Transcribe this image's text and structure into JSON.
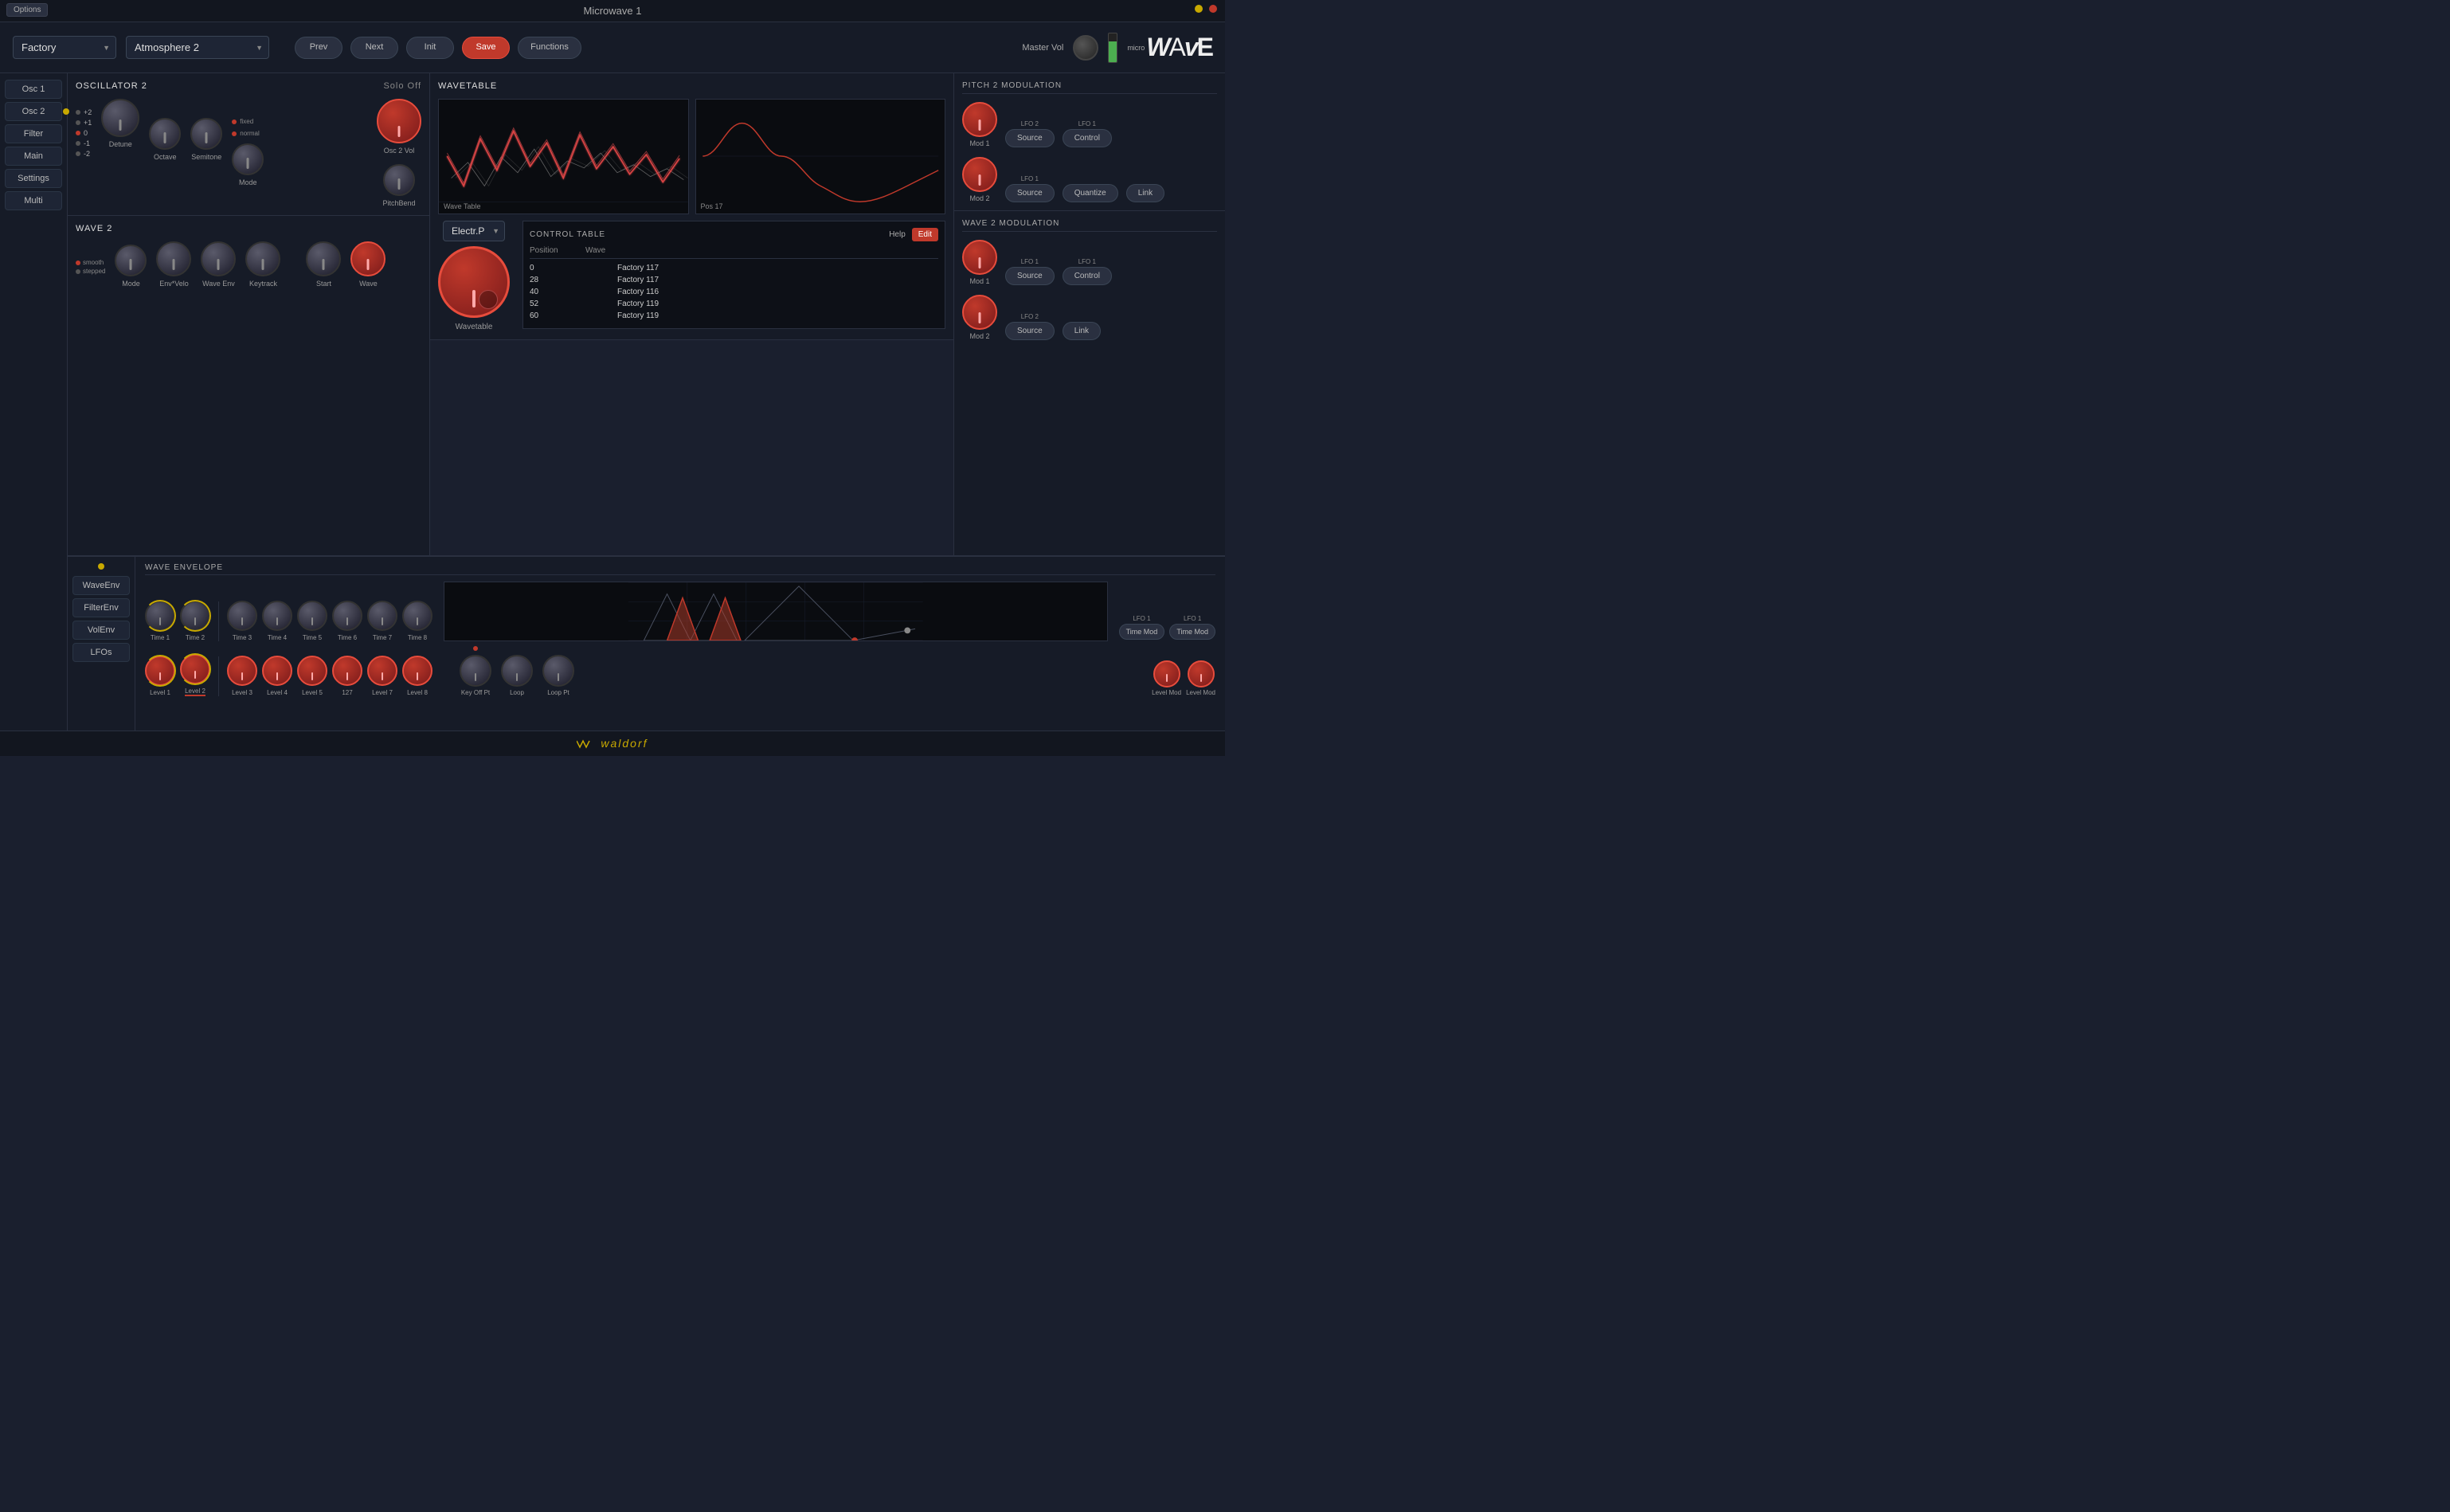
{
  "titleBar": {
    "title": "Microwave 1",
    "optionsLabel": "Options"
  },
  "topBar": {
    "bankLabel": "Factory",
    "presetLabel": "Atmosphere 2",
    "buttons": {
      "prev": "Prev",
      "next": "Next",
      "init": "Init",
      "save": "Save",
      "functions": "Functions"
    },
    "masterVolLabel": "Master Vol",
    "logoMicro": "micro",
    "logoWave": "WAvE"
  },
  "sidebar": {
    "items": [
      {
        "label": "Osc 1"
      },
      {
        "label": "Osc 2"
      },
      {
        "label": "Filter"
      },
      {
        "label": "Main"
      },
      {
        "label": "Settings"
      },
      {
        "label": "Multi"
      }
    ]
  },
  "oscillator2": {
    "title": "OSCILLATOR 2",
    "soloOff": "Solo Off",
    "pitchValues": [
      "+2",
      "+1",
      "0",
      "-1",
      "-2"
    ],
    "knobs": {
      "detune": "Detune",
      "octave": "Octave",
      "semitone": "Semitone",
      "mode": "Mode",
      "osc2vol": "Osc 2 Vol",
      "pitchbend": "PitchBend"
    },
    "fixed": "fixed",
    "normal": "normal"
  },
  "wave2": {
    "title": "WAVE 2",
    "knobs": {
      "envvelo": "Env*Velo",
      "start": "Start",
      "mode": "Mode",
      "waveenv": "Wave Env",
      "keytrack": "Keytrack",
      "wave": "Wave"
    },
    "smooth": "smooth",
    "stepped": "stepped"
  },
  "wavetable": {
    "title": "WAVETABLE",
    "waveTableLabel": "Wave Table",
    "posLabel": "Pos 17",
    "dropdown": "Electr.P",
    "wavetableKnobLabel": "Wavetable"
  },
  "controlTable": {
    "title": "CONTROL TABLE",
    "helpLabel": "Help",
    "editLabel": "Edit",
    "colPosition": "Position",
    "colWave": "Wave",
    "rows": [
      {
        "position": "0",
        "wave": "Factory 117"
      },
      {
        "position": "28",
        "wave": "Factory 117"
      },
      {
        "position": "40",
        "wave": "Factory 116"
      },
      {
        "position": "52",
        "wave": "Factory 119"
      },
      {
        "position": "60",
        "wave": "Factory 119"
      }
    ]
  },
  "pitch2Modulation": {
    "title": "PITCH 2 MODULATION",
    "mod1": "Mod 1",
    "mod2": "Mod 2",
    "source1": "Source",
    "source2": "Source",
    "control": "Control",
    "quantize": "Quantize",
    "link": "Link",
    "lfo2": "LFO 2",
    "lfo1a": "LFO 1",
    "lfo1b": "LFO 1"
  },
  "wave2Modulation": {
    "title": "WAVE 2 MODULATION",
    "mod1": "Mod 1",
    "mod2": "Mod 2",
    "source1": "Source",
    "source2": "Source",
    "control": "Control",
    "link": "Link",
    "lfo1a": "LFO 1",
    "lfo1b": "LFO 1",
    "lfo2": "LFO 2"
  },
  "waveEnvelope": {
    "title": "WAVE ENVELOPE",
    "timeKnobs": [
      "Time 1",
      "Time 2",
      "Time 3",
      "Time 4",
      "Time 5",
      "Time 6",
      "Time 7",
      "Time 8"
    ],
    "levelKnobs": [
      "Level 1",
      "Level 2",
      "Level 3",
      "Level 4",
      "Level 5",
      "127",
      "Level 7",
      "Level 8"
    ],
    "keyOffPt": "Key Off Pt",
    "loop": "Loop",
    "loopPt": "Loop Pt",
    "timeMod1": "Time Mod",
    "timeMod2": "Time Mod",
    "levelMod1": "Level Mod",
    "levelMod2": "Level Mod",
    "lfo1a": "LFO 1",
    "lfo1b": "LFO 1"
  },
  "bottomSidebar": {
    "items": [
      {
        "label": "WaveEnv"
      },
      {
        "label": "FilterEnv"
      },
      {
        "label": "VolEnv"
      },
      {
        "label": "LFOs"
      }
    ]
  },
  "waldorfLogo": "waldorf"
}
